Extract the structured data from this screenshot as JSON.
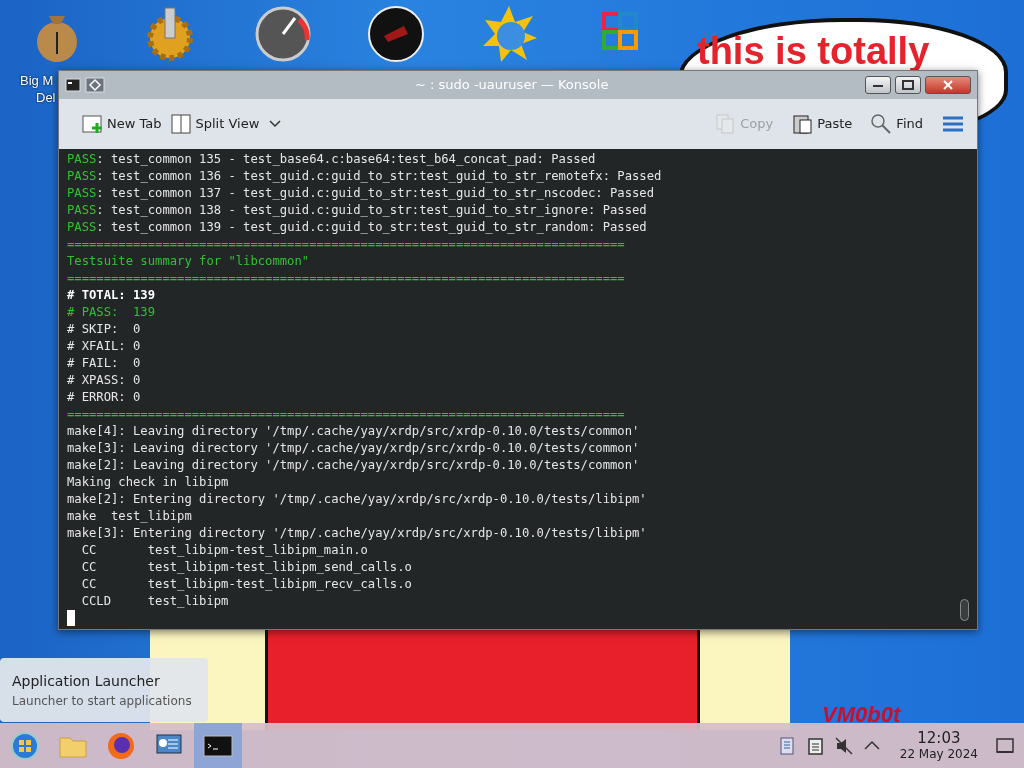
{
  "desktop_icons": [
    {
      "label": "Big M",
      "label_2": "Del",
      "kind": "money"
    },
    {
      "kind": "gear"
    },
    {
      "kind": "gauge"
    },
    {
      "kind": "disc"
    },
    {
      "kind": "sun"
    },
    {
      "kind": "office"
    }
  ],
  "wallpaper": {
    "caption": "this is totally",
    "signature": "VM0b0t"
  },
  "window": {
    "title": "~ : sudo -uauruser — Konsole"
  },
  "toolbar": {
    "left": [
      {
        "label": "New Tab",
        "kind": "newtab",
        "disabled": false
      },
      {
        "label": "Split View",
        "kind": "split",
        "disabled": false
      }
    ],
    "right": [
      {
        "label": "Copy",
        "kind": "copy",
        "disabled": true
      },
      {
        "label": "Paste",
        "kind": "paste",
        "disabled": false
      },
      {
        "label": "Find",
        "kind": "find",
        "disabled": false
      }
    ]
  },
  "terminal": {
    "lines": [
      [
        {
          "text": "PASS",
          "kind": "green"
        },
        {
          "text": ": test_common 135 - test_base64.c:base64:test_b64_concat_pad: Passed",
          "kind": "plain"
        }
      ],
      [
        {
          "text": "PASS",
          "kind": "green"
        },
        {
          "text": ": test_common 136 - test_guid.c:guid_to_str:test_guid_to_str_remotefx: Passed",
          "kind": "plain"
        }
      ],
      [
        {
          "text": "PASS",
          "kind": "green"
        },
        {
          "text": ": test_common 137 - test_guid.c:guid_to_str:test_guid_to_str_nscodec: Passed",
          "kind": "plain"
        }
      ],
      [
        {
          "text": "PASS",
          "kind": "green"
        },
        {
          "text": ": test_common 138 - test_guid.c:guid_to_str:test_guid_to_str_ignore: Passed",
          "kind": "plain"
        }
      ],
      [
        {
          "text": "PASS",
          "kind": "green"
        },
        {
          "text": ": test_common 139 - test_guid.c:guid_to_str:test_guid_to_str_random: Passed",
          "kind": "plain"
        }
      ],
      [
        {
          "text": "============================================================================",
          "kind": "green"
        }
      ],
      [
        {
          "text": "Testsuite summary for \"libcommon\"",
          "kind": "green"
        }
      ],
      [
        {
          "text": "============================================================================",
          "kind": "green"
        }
      ],
      [
        {
          "text": "# TOTAL: 139",
          "kind": "bold"
        }
      ],
      [
        {
          "text": "# PASS:  139",
          "kind": "green"
        }
      ],
      [
        {
          "text": "# SKIP:  0",
          "kind": "plain"
        }
      ],
      [
        {
          "text": "# XFAIL: 0",
          "kind": "plain"
        }
      ],
      [
        {
          "text": "# FAIL:  0",
          "kind": "plain"
        }
      ],
      [
        {
          "text": "# XPASS: 0",
          "kind": "plain"
        }
      ],
      [
        {
          "text": "# ERROR: 0",
          "kind": "plain"
        }
      ],
      [
        {
          "text": "============================================================================",
          "kind": "green"
        }
      ],
      [
        {
          "text": "make[4]: Leaving directory '/tmp/.cache/yay/xrdp/src/xrdp-0.10.0/tests/common'",
          "kind": "plain"
        }
      ],
      [
        {
          "text": "make[3]: Leaving directory '/tmp/.cache/yay/xrdp/src/xrdp-0.10.0/tests/common'",
          "kind": "plain"
        }
      ],
      [
        {
          "text": "make[2]: Leaving directory '/tmp/.cache/yay/xrdp/src/xrdp-0.10.0/tests/common'",
          "kind": "plain"
        }
      ],
      [
        {
          "text": "Making check in libipm",
          "kind": "plain"
        }
      ],
      [
        {
          "text": "make[2]: Entering directory '/tmp/.cache/yay/xrdp/src/xrdp-0.10.0/tests/libipm'",
          "kind": "plain"
        }
      ],
      [
        {
          "text": "make  test_libipm",
          "kind": "plain"
        }
      ],
      [
        {
          "text": "make[3]: Entering directory '/tmp/.cache/yay/xrdp/src/xrdp-0.10.0/tests/libipm'",
          "kind": "plain"
        }
      ],
      [
        {
          "text": "  CC       test_libipm-test_libipm_main.o",
          "kind": "plain"
        }
      ],
      [
        {
          "text": "  CC       test_libipm-test_libipm_send_calls.o",
          "kind": "plain"
        }
      ],
      [
        {
          "text": "  CC       test_libipm-test_libipm_recv_calls.o",
          "kind": "plain"
        }
      ],
      [
        {
          "text": "  CCLD     test_libipm",
          "kind": "plain"
        }
      ]
    ]
  },
  "tooltip": {
    "title": "Application Launcher",
    "subtitle": "Launcher to start applications"
  },
  "taskbar": {
    "items": [
      {
        "kind": "start",
        "selected": false
      },
      {
        "kind": "folder",
        "selected": false
      },
      {
        "kind": "firefox",
        "selected": false
      },
      {
        "kind": "info",
        "selected": false
      },
      {
        "kind": "terminal",
        "selected": true
      }
    ],
    "tray": [
      {
        "kind": "clipboard-doc"
      },
      {
        "kind": "clipboard"
      },
      {
        "kind": "speaker-muted"
      },
      {
        "kind": "chevron"
      }
    ],
    "clock": {
      "time": "12:03",
      "date": "22 May 2024"
    }
  }
}
